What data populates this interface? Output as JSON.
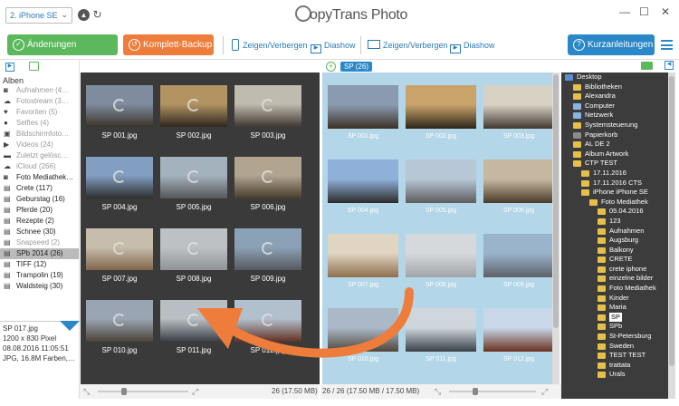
{
  "device": {
    "name": "2. iPhone SE"
  },
  "app": {
    "title": "CopyTrans Photo",
    "logo_rest": "opyTrans Photo"
  },
  "toolbar": {
    "save_label": "Änderungen speichern",
    "backup_label": "Komplett-Backup",
    "toggle_left": "Zeigen/Verbergen",
    "slideshow_left": "Diashow",
    "toggle_right": "Zeigen/Verbergen",
    "slideshow_right": "Diashow",
    "guide_label": "Kurzanleitungen"
  },
  "left": {
    "header": "Alben",
    "albums": [
      {
        "label": "Aufnahmen (4…",
        "icon": "camera-icon",
        "dim": true
      },
      {
        "label": "Fotostream (3…",
        "icon": "cloud-icon",
        "dim": true
      },
      {
        "label": "Favoriten (5)",
        "icon": "heart-icon",
        "dim": true
      },
      {
        "label": "Selfies (4)",
        "icon": "person-icon",
        "dim": true
      },
      {
        "label": "Bildschirmfoto…",
        "icon": "screenshot-icon",
        "dim": true
      },
      {
        "label": "Videos (24)",
        "icon": "video-icon",
        "dim": true
      },
      {
        "label": "Zuletzt gelösc…",
        "icon": "trash-icon",
        "dim": true
      },
      {
        "label": "iCloud (266)",
        "icon": "cloud-icon",
        "dim": true
      },
      {
        "label": "Foto Mediathek…",
        "icon": "camera-icon",
        "dim": false
      },
      {
        "label": "Crete (117)",
        "icon": "album-icon",
        "dim": false
      },
      {
        "label": "Geburstag (16)",
        "icon": "album-icon",
        "dim": false
      },
      {
        "label": "Pferde (20)",
        "icon": "album-icon",
        "dim": false
      },
      {
        "label": "Rezepte (2)",
        "icon": "album-icon",
        "dim": false
      },
      {
        "label": "Schnee (30)",
        "icon": "album-icon",
        "dim": false
      },
      {
        "label": "Snapseed (2)",
        "icon": "album-icon",
        "dim": true
      },
      {
        "label": "SPb 2014 (26)",
        "icon": "album-icon",
        "dim": false,
        "selected": true
      },
      {
        "label": "TIFF (12)",
        "icon": "album-icon",
        "dim": false
      },
      {
        "label": "Trampolin (19)",
        "icon": "album-icon",
        "dim": false
      },
      {
        "label": "Waldsteig (30)",
        "icon": "album-icon",
        "dim": false
      }
    ]
  },
  "info": {
    "name": "SP 017.jpg",
    "size": "1200 x 830 Pixel",
    "date": "08.08.2016 11:05:51",
    "type": "JPG, 16.8M Farben,…"
  },
  "phone_photos": [
    "SP 001.jpg",
    "SP 002.jpg",
    "SP 003.jpg",
    "SP 004.jpg",
    "SP 005.jpg",
    "SP 006.jpg",
    "SP 007.jpg",
    "SP 008.jpg",
    "SP 009.jpg",
    "SP 010.jpg",
    "SP 011.jpg",
    "SP 012.jpg"
  ],
  "pc_pane": {
    "badge": "SP (26)",
    "photos": [
      "SP 001.jpg",
      "SP 002.jpg",
      "SP 003.jpg",
      "SP 004.jpg",
      "SP 005.jpg",
      "SP 006.jpg",
      "SP 007.jpg",
      "SP 008.jpg",
      "SP 009.jpg",
      "SP 010.jpg",
      "SP 011.jpg",
      "SP 012.jpg"
    ]
  },
  "status": {
    "left": "26 (17.50 MB)",
    "right": "26 / 26 (17.50 MB / 17.50 MB)"
  },
  "tree": [
    {
      "label": "Desktop",
      "depth": 0
    },
    {
      "label": "Bibliotheken",
      "depth": 1
    },
    {
      "label": "Alexandra",
      "depth": 1
    },
    {
      "label": "Computer",
      "depth": 1
    },
    {
      "label": "Netzwerk",
      "depth": 1
    },
    {
      "label": "Systemsteuerung",
      "depth": 1
    },
    {
      "label": "Papierkorb",
      "depth": 1
    },
    {
      "label": "AL DE 2",
      "depth": 1
    },
    {
      "label": "Album Artwork",
      "depth": 1
    },
    {
      "label": "CTP TEST",
      "depth": 1
    },
    {
      "label": "17.11.2016",
      "depth": 2
    },
    {
      "label": "17.11.2016 CTS",
      "depth": 2
    },
    {
      "label": "iPhone iPhone SE",
      "depth": 2
    },
    {
      "label": "Foto Mediathek",
      "depth": 3
    },
    {
      "label": "05.04.2016",
      "depth": 4
    },
    {
      "label": "123",
      "depth": 4
    },
    {
      "label": "Aufnahmen",
      "depth": 4
    },
    {
      "label": "Augsburg",
      "depth": 4
    },
    {
      "label": "Balkony",
      "depth": 4
    },
    {
      "label": "CRETE",
      "depth": 4
    },
    {
      "label": "crete iphone",
      "depth": 4
    },
    {
      "label": "einzelne bilder",
      "depth": 4
    },
    {
      "label": "Foto Mediathek",
      "depth": 4
    },
    {
      "label": "Kinder",
      "depth": 4
    },
    {
      "label": "Maria",
      "depth": 4
    },
    {
      "label": "SP",
      "depth": 4,
      "selected": true
    },
    {
      "label": "SPb",
      "depth": 4
    },
    {
      "label": "St-Petersburg",
      "depth": 4
    },
    {
      "label": "Sweden",
      "depth": 4
    },
    {
      "label": "TEST TEST",
      "depth": 4
    },
    {
      "label": "trattata",
      "depth": 4
    },
    {
      "label": "Urals",
      "depth": 4
    }
  ],
  "colors": {
    "green": "#5cb85c",
    "orange": "#ee7d3b",
    "blue": "#2a88c8",
    "arrow": "#ee7d3b"
  }
}
